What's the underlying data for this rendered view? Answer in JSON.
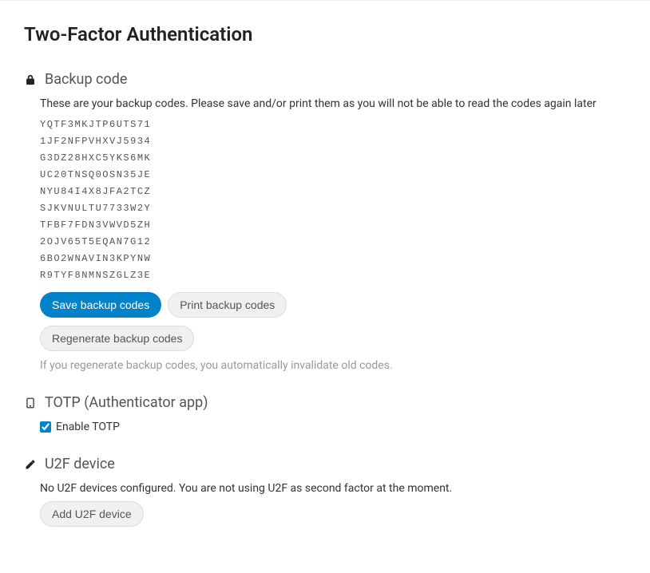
{
  "page": {
    "title": "Two-Factor Authentication"
  },
  "backup": {
    "heading": "Backup code",
    "description": "These are your backup codes. Please save and/or print them as you will not be able to read the codes again later",
    "codes": [
      "YQTF3MKJTP6UTS71",
      "1JF2NFPVHXVJ5934",
      "G3DZ28HXC5YKS6MK",
      "UC20TNSQ0OSN35JE",
      "NYU84I4X8JFA2TCZ",
      "SJKVNULTU7733W2Y",
      "TFBF7FDN3VWVD5ZH",
      "2OJV65T5EQAN7G12",
      "6BO2WNAVIN3KPYNW",
      "R9TYF8NMNSZGLZ3E"
    ],
    "save_label": "Save backup codes",
    "print_label": "Print backup codes",
    "regenerate_label": "Regenerate backup codes",
    "regenerate_note": "If you regenerate backup codes, you automatically invalidate old codes."
  },
  "totp": {
    "heading": "TOTP (Authenticator app)",
    "enable_label": "Enable TOTP",
    "enabled": true
  },
  "u2f": {
    "heading": "U2F device",
    "description": "No U2F devices configured. You are not using U2F as second factor at the moment.",
    "add_label": "Add U2F device"
  }
}
